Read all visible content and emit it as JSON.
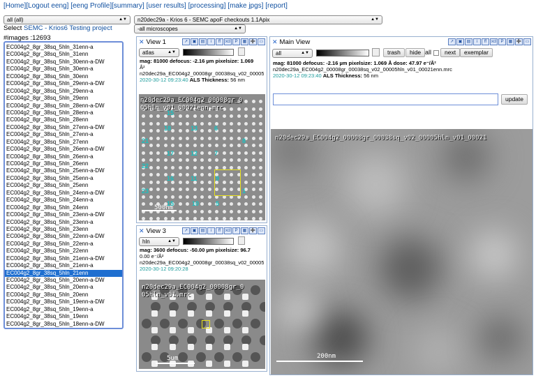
{
  "toplinks": [
    "[Home]",
    "[Logout eeng]",
    "[eeng Profile]",
    "[summary]",
    "[user results]",
    "[processing]",
    "[make jpgs]",
    "[report]"
  ],
  "filters": {
    "user_select": "all (all)",
    "session_select": "n20dec29a - Krios 6 - SEMC apoF checkouts 1.1Apix",
    "microscope_select": "-all microscopes"
  },
  "project": {
    "prefix": "Select ",
    "link": "SEMC - Krios6 Testing project"
  },
  "image_count": "#images :12693",
  "images": [
    "EC004g2_8gr_38sq_5hln_31enn-a",
    "EC004g2_8gr_38sq_5hln_31enn",
    "EC004g2_8gr_38sq_5hln_30enn-a-DW",
    "EC004g2_8gr_38sq_5hln_30enn-a",
    "EC004g2_8gr_38sq_5hln_30enn",
    "EC004g2_8gr_38sq_5hln_29enn-a-DW",
    "EC004g2_8gr_38sq_5hln_29enn-a",
    "EC004g2_8gr_38sq_5hln_29enn",
    "EC004g2_8gr_38sq_5hln_28enn-a-DW",
    "EC004g2_8gr_38sq_5hln_28enn-a",
    "EC004g2_8gr_38sq_5hln_28enn",
    "EC004g2_8gr_38sq_5hln_27enn-a-DW",
    "EC004g2_8gr_38sq_5hln_27enn-a",
    "EC004g2_8gr_38sq_5hln_27enn",
    "EC004g2_8gr_38sq_5hln_26enn-a-DW",
    "EC004g2_8gr_38sq_5hln_26enn-a",
    "EC004g2_8gr_38sq_5hln_26enn",
    "EC004g2_8gr_38sq_5hln_25enn-a-DW",
    "EC004g2_8gr_38sq_5hln_25enn-a",
    "EC004g2_8gr_38sq_5hln_25enn",
    "EC004g2_8gr_38sq_5hln_24enn-a-DW",
    "EC004g2_8gr_38sq_5hln_24enn-a",
    "EC004g2_8gr_38sq_5hln_24enn",
    "EC004g2_8gr_38sq_5hln_23enn-a-DW",
    "EC004g2_8gr_38sq_5hln_23enn-a",
    "EC004g2_8gr_38sq_5hln_23enn",
    "EC004g2_8gr_38sq_5hln_22enn-a-DW",
    "EC004g2_8gr_38sq_5hln_22enn-a",
    "EC004g2_8gr_38sq_5hln_22enn",
    "EC004g2_8gr_38sq_5hln_21enn-a-DW",
    "EC004g2_8gr_38sq_5hln_21enn-a",
    "EC004g2_8gr_38sq_5hln_21enn",
    "EC004g2_8gr_38sq_5hln_20enn-a-DW",
    "EC004g2_8gr_38sq_5hln_20enn-a",
    "EC004g2_8gr_38sq_5hln_20enn",
    "EC004g2_8gr_38sq_5hln_19enn-a-DW",
    "EC004g2_8gr_38sq_5hln_19enn-a",
    "EC004g2_8gr_38sq_5hln_19enn",
    "EC004g2_8gr_38sq_5hln_18enn-a-DW",
    "EC004g2_8gr_38sq_5hln_18enn-a"
  ],
  "selected_index": 31,
  "tools": [
    "↗",
    "▣",
    "▤",
    "i",
    "ff",
    "xcl",
    "P",
    "▦",
    "➕",
    "▭"
  ],
  "view1": {
    "title": "View 1",
    "preset": "atlas",
    "meta_line1": "mag: 81000 defocus: -2.16 µm pixelsize: 1.069",
    "meta_unit": "Å²",
    "filename": "n20dec29a_EC004g2_00008gr_00038sq_v02_00005",
    "timestamp": "2020-30-12 09:23:40",
    "thickness_label": "ALS Thickness:",
    "thickness": "56 nm",
    "overlay": "n20dec29a_EC004g2_00008gr_0",
    "overlay2": "05hln_v01_00021enn.mrc",
    "scale": "500nm",
    "labels": [
      "15",
      "18",
      "13",
      "6",
      "21",
      "8",
      "17",
      "12",
      "7",
      "22",
      "16",
      "11",
      "9",
      "23",
      "15",
      "10",
      "5",
      "1"
    ]
  },
  "view3": {
    "title": "View 3",
    "preset": "hln",
    "meta_line1": "mag: 3600 defocus: -50.00 µm pixelsize: 96.7",
    "meta_line2": "0.00 e⁻/Å²",
    "filename": "n20dec29a_EC004g2_00008gr_00038sq_v02_00005",
    "timestamp": "2020-30-12 09:20:28",
    "overlay": "n20dec29a_EC004g2_00008gr_0",
    "overlay2": "05hln_v01.mrc",
    "scale": "5um"
  },
  "main": {
    "title": "Main View",
    "preset": "all",
    "buttons": {
      "trash": "trash",
      "hide": "hide",
      "all": "all",
      "next": "next",
      "exemplar": "exemplar"
    },
    "meta_line1": "mag: 81000 defocus: -2.16 µm pixelsize: 1.069 Å dose: 47.97 e⁻/Å²",
    "filename": "n20dec29a_EC004g2_00008gr_00038sq_v02_00005hln_v01_00021enn.mrc",
    "timestamp": "2020-30-12 09:23:40",
    "thickness_label": "ALS Thickness:",
    "thickness": "56 nm",
    "comment_placeholder": "",
    "update_label": "update",
    "overlay": "n20dec29a_EC004g2_00008gr_00038sq_v02_00005hln_v01_00021",
    "scale": "200nm"
  },
  "colors": {
    "link": "#1050a0",
    "selection": "#1f6fd0",
    "teal": "#1a9a9a",
    "label_cyan": "#19c0c0"
  }
}
